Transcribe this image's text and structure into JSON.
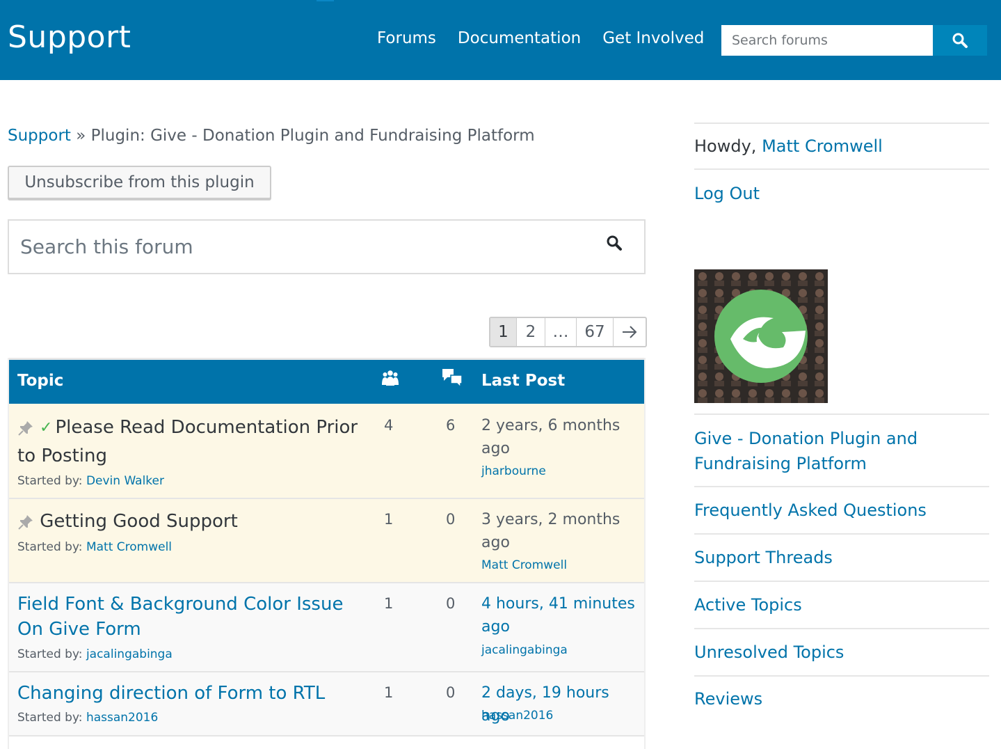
{
  "header": {
    "site_title": "Support",
    "nav": [
      "Forums",
      "Documentation",
      "Get Involved"
    ],
    "search_placeholder": "Search forums"
  },
  "breadcrumb": {
    "root": "Support",
    "separator": "»",
    "current": "Plugin: Give - Donation Plugin and Fundraising Platform"
  },
  "unsubscribe_label": "Unsubscribe from this plugin",
  "forum_search_placeholder": "Search this forum",
  "pagination": {
    "current": "1",
    "pages": [
      "2",
      "…",
      "67"
    ]
  },
  "table": {
    "header_topic": "Topic",
    "header_last_post": "Last Post",
    "rows": [
      {
        "title": "Please Read Documentation Prior to Posting",
        "started_label": "Started by:",
        "author": "Devin Walker",
        "voices": "4",
        "replies": "6",
        "freshness": "2 years, 6 months ago",
        "last_by": "jharbourne"
      },
      {
        "title": "Getting Good Support",
        "started_label": "Started by:",
        "author": "Matt Cromwell",
        "voices": "1",
        "replies": "0",
        "freshness": "3 years, 2 months ago",
        "last_by": "Matt Cromwell"
      },
      {
        "title": "Field Font & Background Color Issue On Give Form",
        "started_label": "Started by:",
        "author": "jacalingabinga",
        "voices": "1",
        "replies": "0",
        "freshness": "4 hours, 41 minutes ago",
        "last_by": "jacalingabinga"
      },
      {
        "title": "Changing direction of Form to RTL",
        "started_label": "Started by:",
        "author": "hassan2016",
        "voices": "1",
        "replies": "0",
        "freshness": "2 days, 19 hours ago",
        "last_by": "hassan2016"
      }
    ]
  },
  "sidebar": {
    "howdy_prefix": "Howdy,",
    "user": "Matt Cromwell",
    "logout": "Log Out",
    "links": [
      "Give - Donation Plugin and Fundraising Platform",
      "Frequently Asked Questions",
      "Support Threads",
      "Active Topics",
      "Unresolved Topics",
      "Reviews"
    ]
  },
  "colors": {
    "header_bg": "#0073aa",
    "link": "#0073aa",
    "sticky_row_bg": "#fdf8e6",
    "resolved_check": "#46b450",
    "give_logo_green": "#66bb6a"
  }
}
